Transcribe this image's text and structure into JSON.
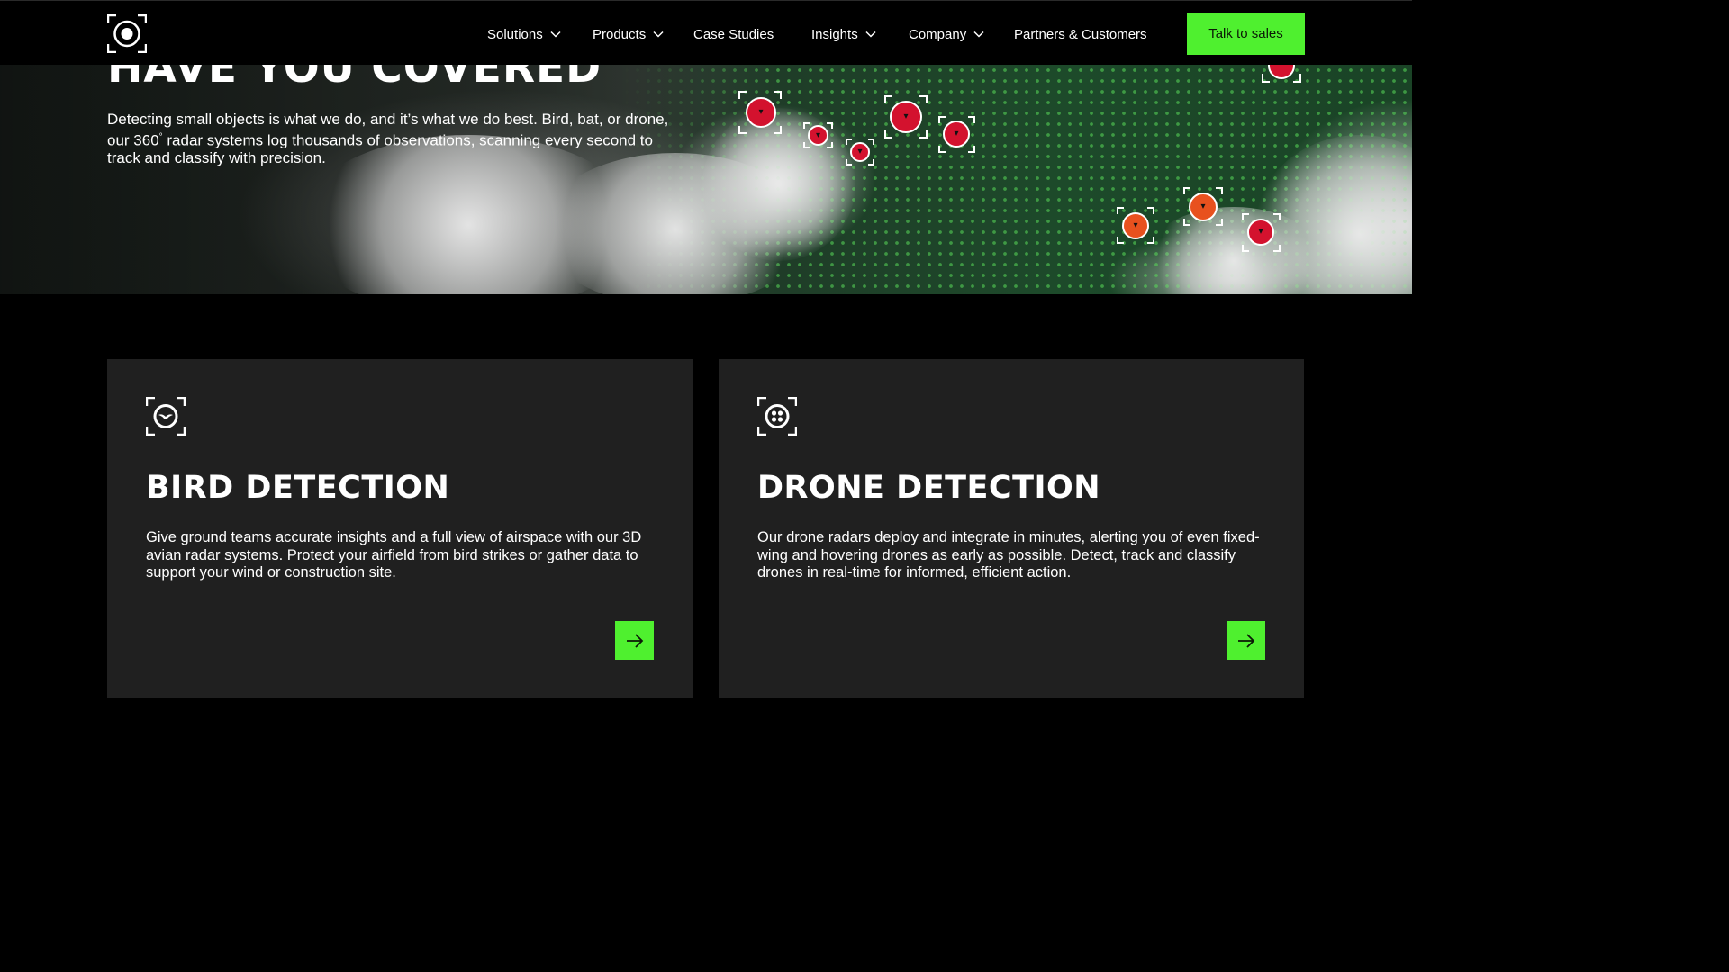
{
  "nav": {
    "logo": "radar-logo-icon",
    "items": [
      {
        "label": "Solutions",
        "has_dropdown": true
      },
      {
        "label": "Products",
        "has_dropdown": true
      },
      {
        "label": "Case Studies",
        "has_dropdown": false
      },
      {
        "label": "Insights",
        "has_dropdown": true
      },
      {
        "label": "Company",
        "has_dropdown": true
      },
      {
        "label": "Partners & Customers",
        "has_dropdown": false
      }
    ],
    "cta_label": "Talk to sales"
  },
  "hero": {
    "heading": "HAVE YOU COVERED",
    "text_part1": "Detecting small objects is what we do, and it’s what we do best. Bird, bat, or drone, our 360",
    "degree": "°",
    "text_part2": " radar systems log thousands of observations, scanning every second to track and classify with precision."
  },
  "cards": [
    {
      "icon": "bird-target-icon",
      "title": "BIRD DETECTION",
      "description": "Give ground teams accurate insights and a full view of airspace with our 3D avian radar systems. Protect your airfield from bird strikes or gather data to support your wind or construction site.",
      "arrow_icon": "arrow-right-icon"
    },
    {
      "icon": "drone-target-icon",
      "title": "DRONE DETECTION",
      "description": "Our drone radars deploy and integrate in minutes, alerting you of even fixed-wing and hovering drones as early as possible. Detect, track and classify drones in real-time for informed, efficient action.",
      "arrow_icon": "arrow-right-icon"
    }
  ],
  "colors": {
    "accent": "#4ff02f",
    "background": "#000000",
    "card": "#202020",
    "target_red": "#d3122e",
    "target_orange": "#e8511e"
  }
}
